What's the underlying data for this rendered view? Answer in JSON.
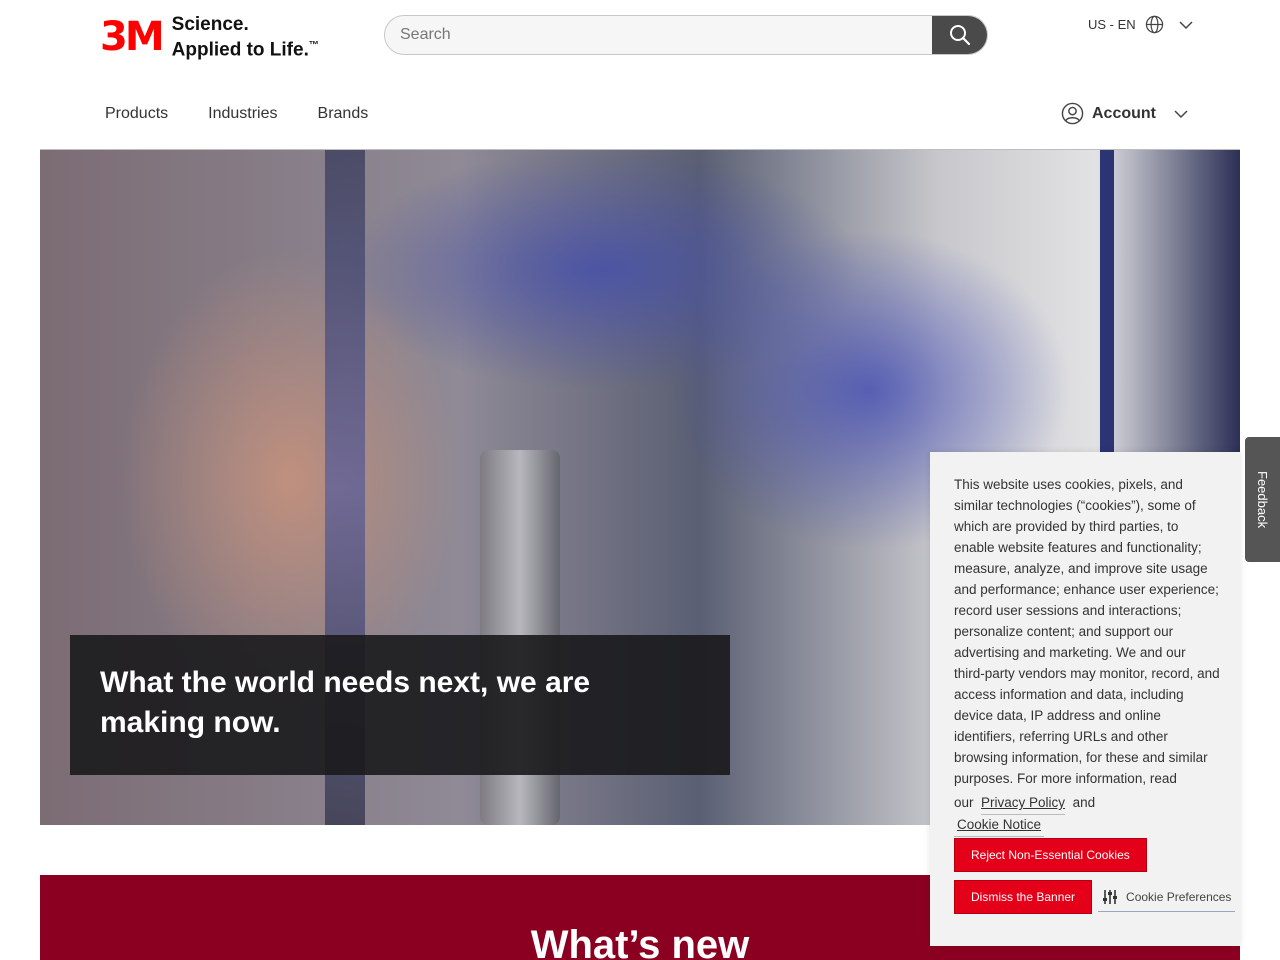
{
  "header": {
    "logo_mark": "3M",
    "logo_line1": "Science.",
    "logo_line2": "Applied to Life.",
    "logo_tm": "™",
    "search_placeholder": "Search",
    "locale": "US - EN"
  },
  "nav": {
    "items": [
      "Products",
      "Industries",
      "Brands"
    ],
    "account_label": "Account"
  },
  "hero": {
    "headline_line1": "What the world needs next, we are",
    "headline_line2": "making now."
  },
  "section": {
    "heading": "What’s new"
  },
  "feedback": {
    "label": "Feedback"
  },
  "cookie": {
    "text": "This website uses cookies, pixels, and similar technologies (“cookies”), some of which are provided by third parties, to enable website features and functionality; measure, analyze, and improve site usage and performance; enhance user experience; record user sessions and interactions; personalize content; and support our advertising and marketing. We and our third-party vendors may monitor, record, and access information and data, including device data, IP address and online identifiers, referring URLs and other browsing information, for these and similar purposes. For more information, read",
    "our": "our",
    "privacy_link": "Privacy Policy",
    "and": "and",
    "notice_link": "Cookie Notice",
    "reject_label": "Reject Non-Essential Cookies",
    "dismiss_label": "Dismiss the Banner",
    "preferences_label": "Cookie Preferences"
  },
  "colors": {
    "brand_red": "#ff0000",
    "button_red": "#e50019",
    "section_red": "#8b0020"
  }
}
